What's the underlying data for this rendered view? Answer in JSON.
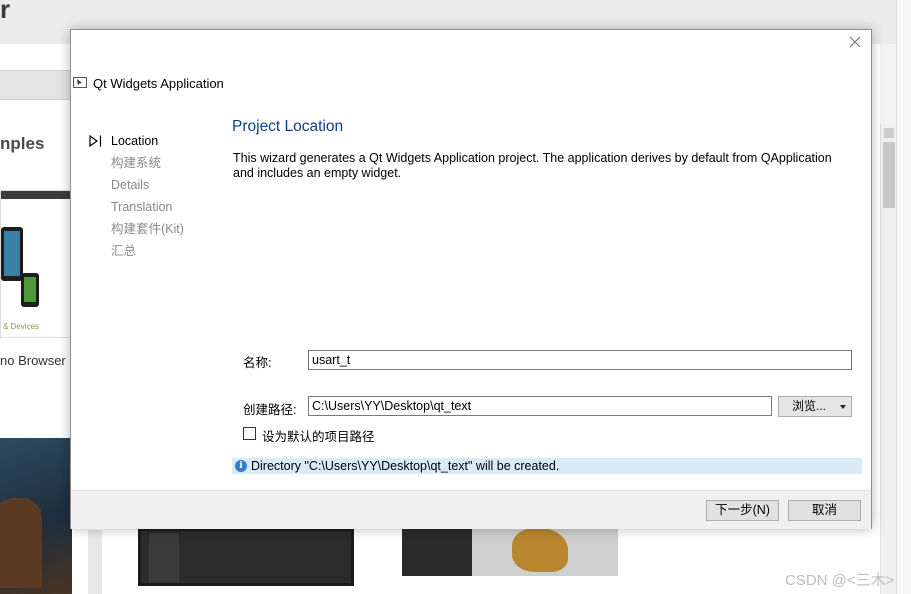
{
  "background": {
    "title_fragment": "r",
    "examples_heading_fragment": "nples",
    "card_caption_fragment": "& Devices",
    "browser_label_fragment": "no Browser"
  },
  "dialog": {
    "title": "Qt Widgets Application",
    "close_icon": "close-icon",
    "steps": [
      {
        "label": "Location",
        "active": true
      },
      {
        "label": "构建系统",
        "active": false
      },
      {
        "label": "Details",
        "active": false
      },
      {
        "label": "Translation",
        "active": false
      },
      {
        "label": "构建套件(Kit)",
        "active": false
      },
      {
        "label": "汇总",
        "active": false
      }
    ],
    "page_title": "Project Location",
    "description": "This wizard generates a Qt Widgets Application project. The application derives by default from QApplication and includes an empty widget.",
    "name_label": "名称:",
    "name_value": "usart_t",
    "path_label": "创建路径:",
    "path_value": "C:\\Users\\YY\\Desktop\\qt_text",
    "browse_label": "浏览...",
    "default_path_checkbox": {
      "label": "设为默认的项目路径",
      "checked": false
    },
    "info_message": "Directory \"C:\\Users\\YY\\Desktop\\qt_text\" will be created.",
    "buttons": {
      "next": "下一步(N)",
      "cancel": "取消"
    }
  },
  "watermark": "CSDN @<三木>",
  "colors": {
    "page_title": "#0b3f8c",
    "info_bar": "#dbeaf7",
    "inactive_step": "#8a8a8a"
  }
}
